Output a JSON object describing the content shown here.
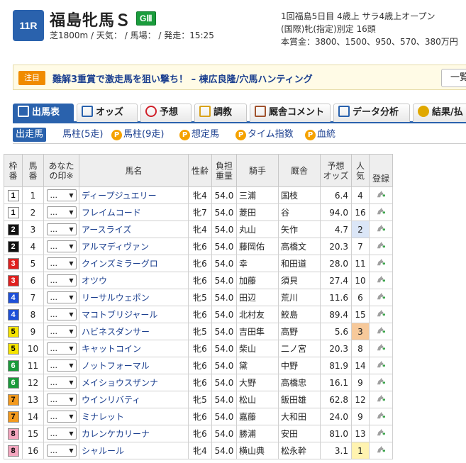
{
  "header": {
    "race_number": "11R",
    "race_name": "福島牝馬Ｓ",
    "grade": "GⅢ",
    "conditions": "芝1800m / 天気： / 馬場： / 発走：15:25",
    "meeting": "1回福島5日目 4歳上 サラ4歳上オープン",
    "class": "(国際)牝(指定)別定 16頭",
    "prize": "本賞金：3800、1500、950、570、380万円"
  },
  "notice": {
    "tag": "注目",
    "text": "難解3重賞で激走馬を狙い撃ち！ – 棟広良隆/穴馬ハンティング",
    "button": "一覧"
  },
  "tabs": [
    {
      "label": "出馬表",
      "icon": "table-icon",
      "color": "#ffffff"
    },
    {
      "label": "オッズ",
      "icon": "odds-grid-icon",
      "color": "#2a62ad"
    },
    {
      "label": "予想",
      "icon": "target-icon",
      "color": "#d0202a"
    },
    {
      "label": "調教",
      "icon": "stopwatch-icon",
      "color": "#d9a21b"
    },
    {
      "label": "厩舎コメント",
      "icon": "stable-house-icon",
      "color": "#a0522d"
    },
    {
      "label": "データ分析",
      "icon": "bar-chart-icon",
      "color": "#2a62ad"
    },
    {
      "label": "結果/払",
      "icon": "coins-icon",
      "color": "#e0a800"
    }
  ],
  "subtabs": [
    {
      "label": "出走馬",
      "premium": false
    },
    {
      "label": "馬柱(5走)",
      "premium": false
    },
    {
      "label": "馬柱(9走)",
      "premium": true
    },
    {
      "label": "想定馬",
      "premium": true
    },
    {
      "label": "タイム指数",
      "premium": true
    },
    {
      "label": "血統",
      "premium": true
    }
  ],
  "premium_badge": "P",
  "table": {
    "headers": {
      "waku": [
        "枠",
        "番"
      ],
      "umaban": [
        "馬",
        "番"
      ],
      "mark": [
        "あなた",
        "の印※"
      ],
      "name": "馬名",
      "sexage": "性齢",
      "weight": [
        "負担",
        "重量"
      ],
      "jockey": "騎手",
      "trainer": "厩舎",
      "odds": [
        "予想",
        "オッズ"
      ],
      "pop": [
        "人",
        "気"
      ],
      "register": "登録"
    },
    "mark_default": "...",
    "waku_colors": {
      "1": {
        "bg": "#ffffff",
        "fg": "#000000"
      },
      "2": {
        "bg": "#111111",
        "fg": "#ffffff"
      },
      "3": {
        "bg": "#e0201f",
        "fg": "#ffffff"
      },
      "4": {
        "bg": "#1e50d8",
        "fg": "#ffffff"
      },
      "5": {
        "bg": "#f5e400",
        "fg": "#000000"
      },
      "6": {
        "bg": "#1a9a3a",
        "fg": "#ffffff"
      },
      "7": {
        "bg": "#f39a1e",
        "fg": "#000000"
      },
      "8": {
        "bg": "#f4a6bf",
        "fg": "#000000"
      }
    },
    "rows": [
      {
        "waku": "1",
        "umaban": "1",
        "name": "ディープジュエリー",
        "sexage": "牝4",
        "weight": "54.0",
        "jockey": "三浦",
        "trainer": "国枝",
        "odds": "6.4",
        "pop": "4"
      },
      {
        "waku": "1",
        "umaban": "2",
        "name": "フレイムコード",
        "sexage": "牝7",
        "weight": "54.0",
        "jockey": "菱田",
        "trainer": "谷",
        "odds": "94.0",
        "pop": "16"
      },
      {
        "waku": "2",
        "umaban": "3",
        "name": "アースライズ",
        "sexage": "牝4",
        "weight": "54.0",
        "jockey": "丸山",
        "trainer": "矢作",
        "odds": "4.7",
        "pop": "2"
      },
      {
        "waku": "2",
        "umaban": "4",
        "name": "アルマディヴァン",
        "sexage": "牝6",
        "weight": "54.0",
        "jockey": "藤岡佑",
        "trainer": "高橋文",
        "odds": "20.3",
        "pop": "7"
      },
      {
        "waku": "3",
        "umaban": "5",
        "name": "クインズミラーグロ",
        "sexage": "牝6",
        "weight": "54.0",
        "jockey": "幸",
        "trainer": "和田道",
        "odds": "28.0",
        "pop": "11"
      },
      {
        "waku": "3",
        "umaban": "6",
        "name": "オツウ",
        "sexage": "牝6",
        "weight": "54.0",
        "jockey": "加藤",
        "trainer": "須貝",
        "odds": "27.4",
        "pop": "10"
      },
      {
        "waku": "4",
        "umaban": "7",
        "name": "リーサルウェポン",
        "sexage": "牝5",
        "weight": "54.0",
        "jockey": "田辺",
        "trainer": "荒川",
        "odds": "11.6",
        "pop": "6"
      },
      {
        "waku": "4",
        "umaban": "8",
        "name": "マコトブリジャール",
        "sexage": "牝6",
        "weight": "54.0",
        "jockey": "北村友",
        "trainer": "鮫島",
        "odds": "89.4",
        "pop": "15"
      },
      {
        "waku": "5",
        "umaban": "9",
        "name": "ハビネスダンサー",
        "sexage": "牝5",
        "weight": "54.0",
        "jockey": "吉田隼",
        "trainer": "高野",
        "odds": "5.6",
        "pop": "3"
      },
      {
        "waku": "5",
        "umaban": "10",
        "name": "キャットコイン",
        "sexage": "牝6",
        "weight": "54.0",
        "jockey": "柴山",
        "trainer": "二ノ宮",
        "odds": "20.3",
        "pop": "8"
      },
      {
        "waku": "6",
        "umaban": "11",
        "name": "ノットフォーマル",
        "sexage": "牝6",
        "weight": "54.0",
        "jockey": "黛",
        "trainer": "中野",
        "odds": "81.9",
        "pop": "14"
      },
      {
        "waku": "6",
        "umaban": "12",
        "name": "メイショウスザンナ",
        "sexage": "牝6",
        "weight": "54.0",
        "jockey": "大野",
        "trainer": "高橋忠",
        "odds": "16.1",
        "pop": "9"
      },
      {
        "waku": "7",
        "umaban": "13",
        "name": "ウインリバティ",
        "sexage": "牝5",
        "weight": "54.0",
        "jockey": "松山",
        "trainer": "飯田雄",
        "odds": "62.8",
        "pop": "12"
      },
      {
        "waku": "7",
        "umaban": "14",
        "name": "ミナレット",
        "sexage": "牝6",
        "weight": "54.0",
        "jockey": "嘉藤",
        "trainer": "大和田",
        "odds": "24.0",
        "pop": "9"
      },
      {
        "waku": "8",
        "umaban": "15",
        "name": "カレンケカリーナ",
        "sexage": "牝6",
        "weight": "54.0",
        "jockey": "勝浦",
        "trainer": "安田",
        "odds": "81.0",
        "pop": "13"
      },
      {
        "waku": "8",
        "umaban": "16",
        "name": "シャルール",
        "sexage": "牝4",
        "weight": "54.0",
        "jockey": "横山典",
        "trainer": "松永幹",
        "odds": "3.1",
        "pop": "1"
      }
    ]
  }
}
